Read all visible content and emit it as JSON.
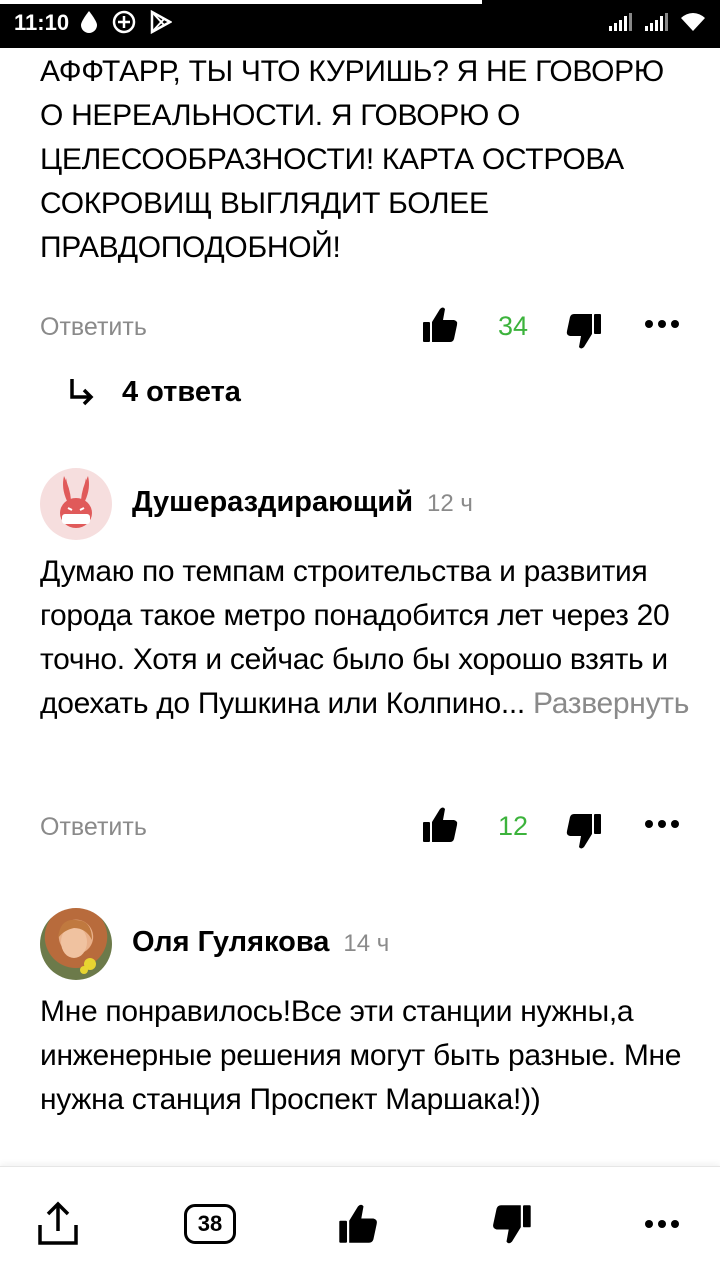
{
  "status": {
    "time": "11:10"
  },
  "comments": [
    {
      "text": "АФФТАРР, ТЫ ЧТО КУРИШЬ? Я НЕ ГОВОРЮ О НЕРЕАЛЬНОСТИ. Я ГОВОРЮ О ЦЕЛЕСООБРАЗНОСТИ! КАРТА ОСТРОВА СОКРОВИЩ ВЫГЛЯДИТ БОЛЕЕ ПРАВДОПОДОБНОЙ!",
      "reply_label": "Ответить",
      "likes": "34",
      "replies_label": "4 ответа"
    },
    {
      "author": "Душераздирающий",
      "time": "12 ч",
      "text": "Думаю по темпам строительства и развития города такое метро понадобится лет через 20 точно. Хотя и сейчас было бы хорошо взять и доехать до Пушкина или Колпино...",
      "expand_label": "Развернуть",
      "reply_label": "Ответить",
      "likes": "12"
    },
    {
      "author": "Оля Гулякова",
      "time": "14 ч",
      "text": "Мне понравилось!Все эти станции нужны,а инженерные решения могут быть разные. Мне нужна станция Проспект Маршака!))"
    }
  ],
  "bottombar": {
    "comments_count": "38"
  },
  "colors": {
    "like_green": "#3cb33c",
    "muted": "#8a8a8a"
  }
}
